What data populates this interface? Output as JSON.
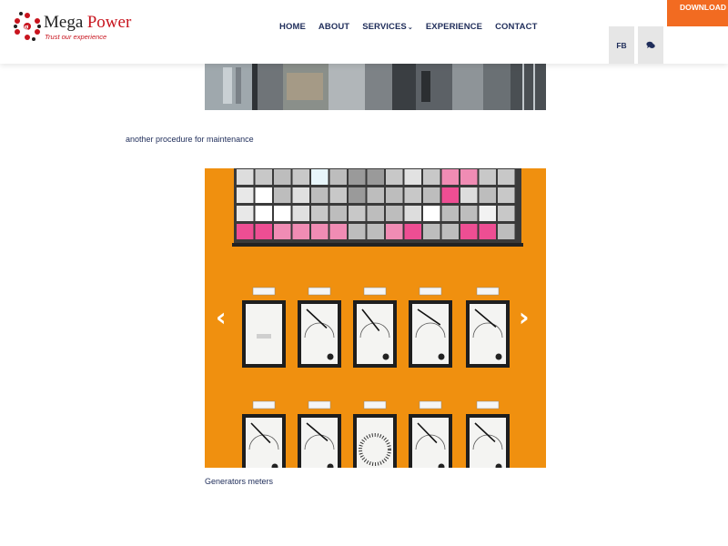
{
  "header": {
    "brand_part1": "Mega",
    "brand_part2": "Power",
    "tagline": "Trust our experience",
    "nav": [
      {
        "label": "HOME"
      },
      {
        "label": "ABOUT"
      },
      {
        "label": "SERVICES",
        "has_dropdown": true
      },
      {
        "label": "EXPERIENCE"
      },
      {
        "label": "CONTACT"
      }
    ],
    "download_label": "DOWNLOAD OUR",
    "fb_label": "FB",
    "chat_icon": "chat-icon"
  },
  "content": {
    "caption_maintenance": "another procedure for maintenance",
    "carousel_prev": "‹",
    "carousel_next": "›",
    "carousel_caption": "Generators meters"
  },
  "colors": {
    "accent_orange": "#f26b21",
    "navy": "#1f2d5a",
    "brand_red": "#c8141e",
    "panel_orange": "#f09014"
  }
}
